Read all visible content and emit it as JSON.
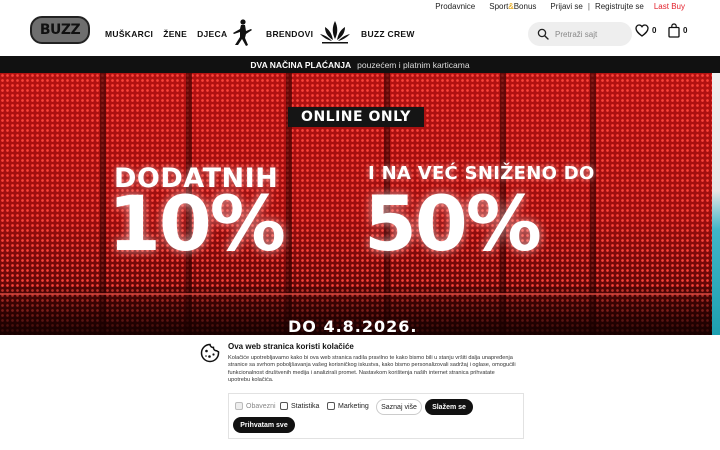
{
  "top_links": {
    "stores": "Prodavnice",
    "sport_bonus_a": "Sport",
    "sport_bonus_amp": "&",
    "sport_bonus_b": "Bonus",
    "login": "Prijavi se",
    "separator": "|",
    "register": "Registrujte se",
    "last_buy": "Last Buy"
  },
  "header": {
    "logo_text": "BUZZ",
    "nav": {
      "men": "MUŠKARCI",
      "women": "ŽENE",
      "kids": "DJECA",
      "brands": "BRENDOVI",
      "crew": "BUZZ CREW"
    },
    "search_placeholder": "Pretraži sajt",
    "wishlist_count": "0",
    "cart_count": "0"
  },
  "payment_strip": {
    "title": "DVA NAČINA PLAĆANJA",
    "subtitle": "pouzećem i platnim karticama"
  },
  "hero": {
    "badge": "ONLINE ONLY",
    "left_label": "DODATNIH",
    "left_big": "10%",
    "right_label": "I NA VEĆ SNIŽENO DO",
    "right_big": "50%",
    "date": "DO 4.8.2026."
  },
  "cookie": {
    "title": "Ova web stranica koristi kolačiće",
    "text": "Kolačiće upotrebljavamo kako bi ova web stranica radila pravilno te kako bismo bili u stanju vršiti dalja unapređenja stranice sa svrhom poboljšavanja vašeg korisničkog iskustva, kako bismo personalizovali sadržaj i oglase, omogućili funkcionalnost društvenih medija i analizirali promet. Nastavkom korištenja naših internet stranica prihvatate upotrebu kolačića.",
    "options": {
      "necessary": "Obavezni",
      "statistics": "Statistika",
      "marketing": "Marketing"
    },
    "buttons": {
      "more": "Saznaj više",
      "agree": "Slažem se",
      "accept_all": "Prihvatam sve"
    }
  },
  "colors": {
    "accent_red": "#e3202b",
    "sport_amp": "#e4a000",
    "hero_red": "#b31212",
    "dark": "#111111"
  }
}
